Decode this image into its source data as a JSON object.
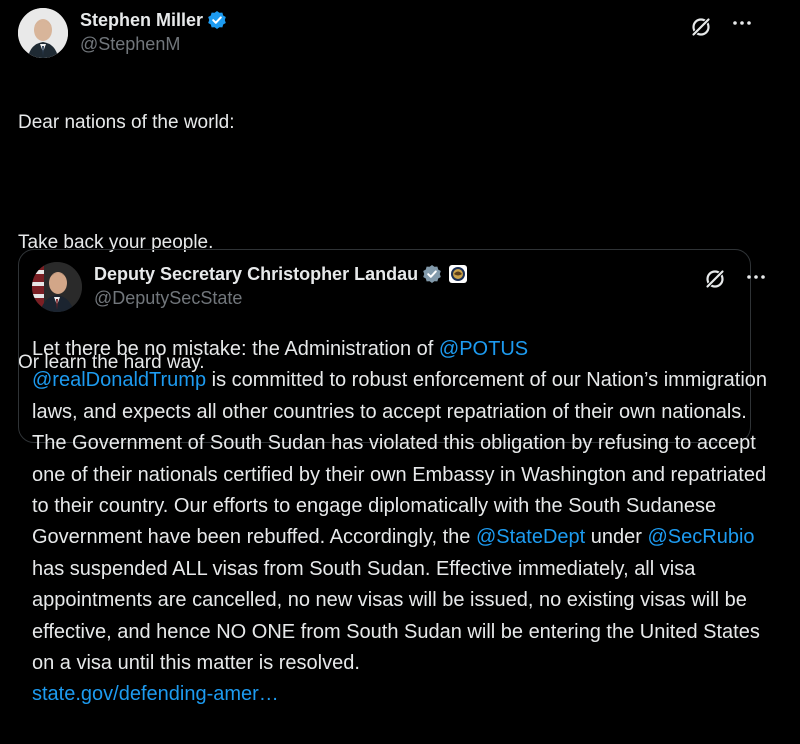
{
  "post": {
    "author": {
      "display_name": "Stephen Miller",
      "handle": "@StephenM",
      "verified": true,
      "avatar_icon": "avatar-photo"
    },
    "text_lines": [
      "Dear nations of the world:",
      "",
      "Take back your people.",
      "",
      "Or learn the hard way."
    ]
  },
  "quoted_post": {
    "author": {
      "display_name": "Deputy Secretary Christopher Landau",
      "handle": "@DeputySecState",
      "verified": true,
      "affiliation_icon": "state-department-seal-icon"
    },
    "text_segments": [
      {
        "type": "text",
        "value": "Let there be no mistake: the Administration of "
      },
      {
        "type": "mention",
        "value": "@POTUS"
      },
      {
        "type": "text",
        "value": " "
      },
      {
        "type": "mention",
        "value": "@realDonaldTrump"
      },
      {
        "type": "text",
        "value": " is committed to robust enforcement of our Nation’s immigration laws, and expects all other countries to accept repatriation of their own nationals. The Government of South Sudan has violated this obligation by refusing to accept one of their nationals certified by their own Embassy in Washington and repatriated to their country. Our efforts to engage diplomatically with the South Sudanese Government have been rebuffed. Accordingly, the "
      },
      {
        "type": "mention",
        "value": "@StateDept"
      },
      {
        "type": "text",
        "value": " under "
      },
      {
        "type": "mention",
        "value": "@SecRubio"
      },
      {
        "type": "text",
        "value": " has suspended ALL visas from South Sudan. Effective immediately, all visa appointments are cancelled, no new visas will be issued, no existing visas will be effective, and hence NO ONE from South Sudan will be entering the United States on a visa until this matter is resolved."
      },
      {
        "type": "link",
        "value": "state.gov/defending-amer…"
      }
    ]
  },
  "colors": {
    "background": "#000000",
    "text": "#e7e9ea",
    "secondary": "#71767b",
    "link": "#1d9bf0",
    "border": "#2f3336"
  },
  "icons": {
    "verified": "verified-badge-icon",
    "grok": "grok-icon",
    "more": "more-icon"
  }
}
